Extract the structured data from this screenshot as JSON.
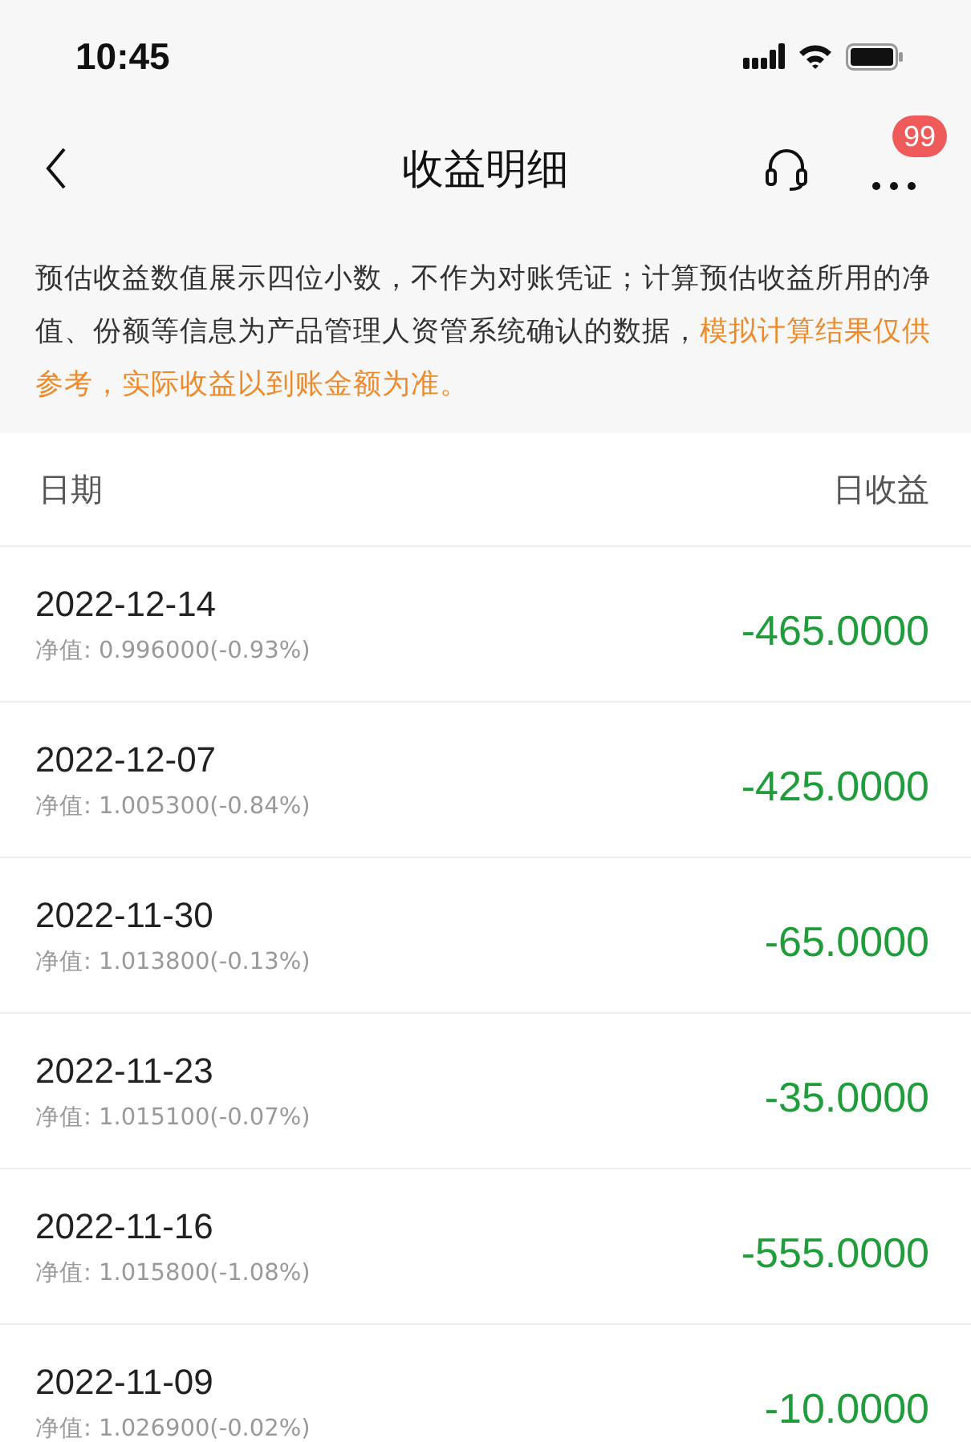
{
  "status_bar": {
    "time": "10:45"
  },
  "nav": {
    "title": "收益明细",
    "badge": "99"
  },
  "notice": {
    "text": "预估收益数值展示四位小数，不作为对账凭证；计算预估收益所用的净值、份额等信息为产品管理人资管系统确认的数据，",
    "highlight": "模拟计算结果仅供参考，实际收益以到账金额为准。"
  },
  "table": {
    "columns": [
      "日期",
      "日收益"
    ],
    "rows": [
      {
        "date": "2022-12-14",
        "nav": "净值: 0.996000(-0.93%)",
        "income": "-465.0000"
      },
      {
        "date": "2022-12-07",
        "nav": "净值: 1.005300(-0.84%)",
        "income": "-425.0000"
      },
      {
        "date": "2022-11-30",
        "nav": "净值: 1.013800(-0.13%)",
        "income": "-65.0000"
      },
      {
        "date": "2022-11-23",
        "nav": "净值: 1.015100(-0.07%)",
        "income": "-35.0000"
      },
      {
        "date": "2022-11-16",
        "nav": "净值: 1.015800(-1.08%)",
        "income": "-555.0000"
      },
      {
        "date": "2022-11-09",
        "nav": "净值: 1.026900(-0.02%)",
        "income": "-10.0000"
      }
    ]
  }
}
